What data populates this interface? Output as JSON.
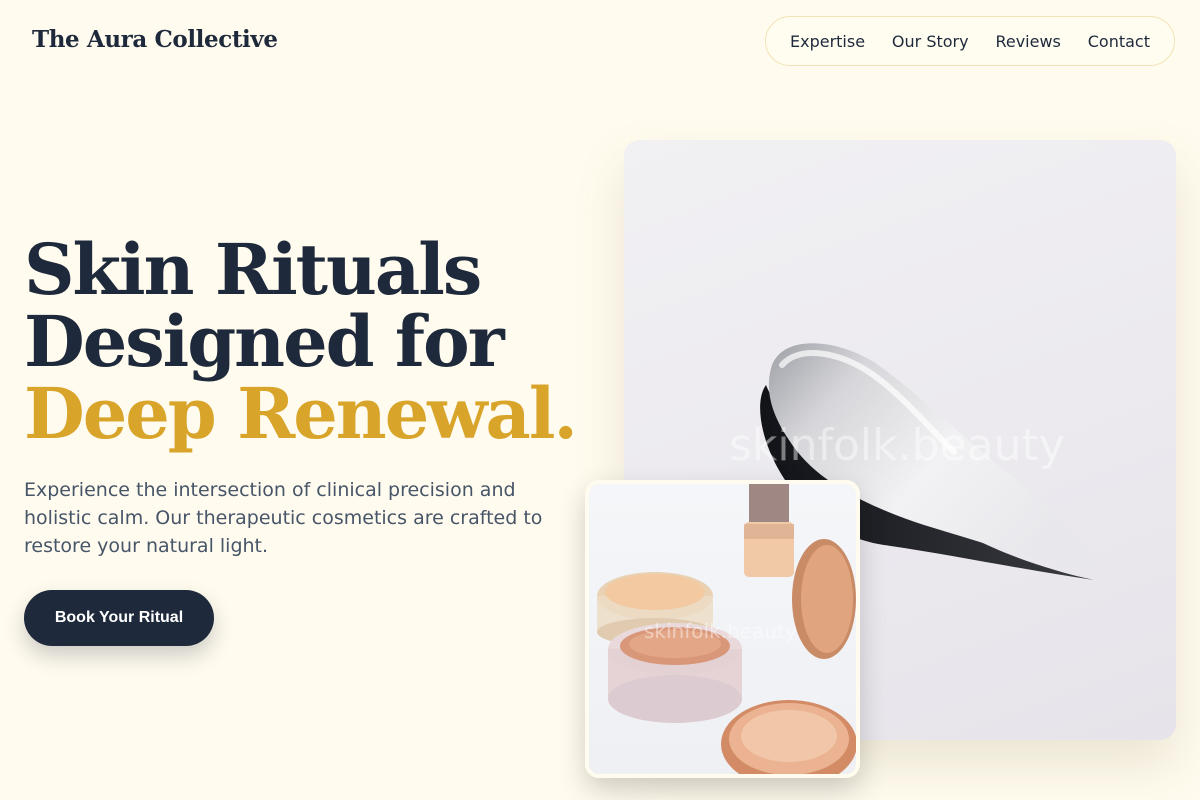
{
  "brand": {
    "name": "The Aura Collective"
  },
  "nav": {
    "items": [
      {
        "label": "Expertise"
      },
      {
        "label": "Our Story"
      },
      {
        "label": "Reviews"
      },
      {
        "label": "Contact"
      }
    ]
  },
  "hero": {
    "headline_line1": "Skin Rituals",
    "headline_line2": "Designed for",
    "headline_accent": "Deep Renewal.",
    "description": "Experience the intersection of clinical precision and holistic calm. Our therapeutic cosmetics are crafted to restore your natural light.",
    "cta_label": "Book Your Ritual"
  },
  "images": {
    "main_watermark": "skinfolk.beauty",
    "inset_watermark": "skinfolk.beauty"
  },
  "colors": {
    "background": "#fffbee",
    "primary": "#1e293b",
    "accent": "#d9a42a",
    "body_text": "#475569"
  }
}
